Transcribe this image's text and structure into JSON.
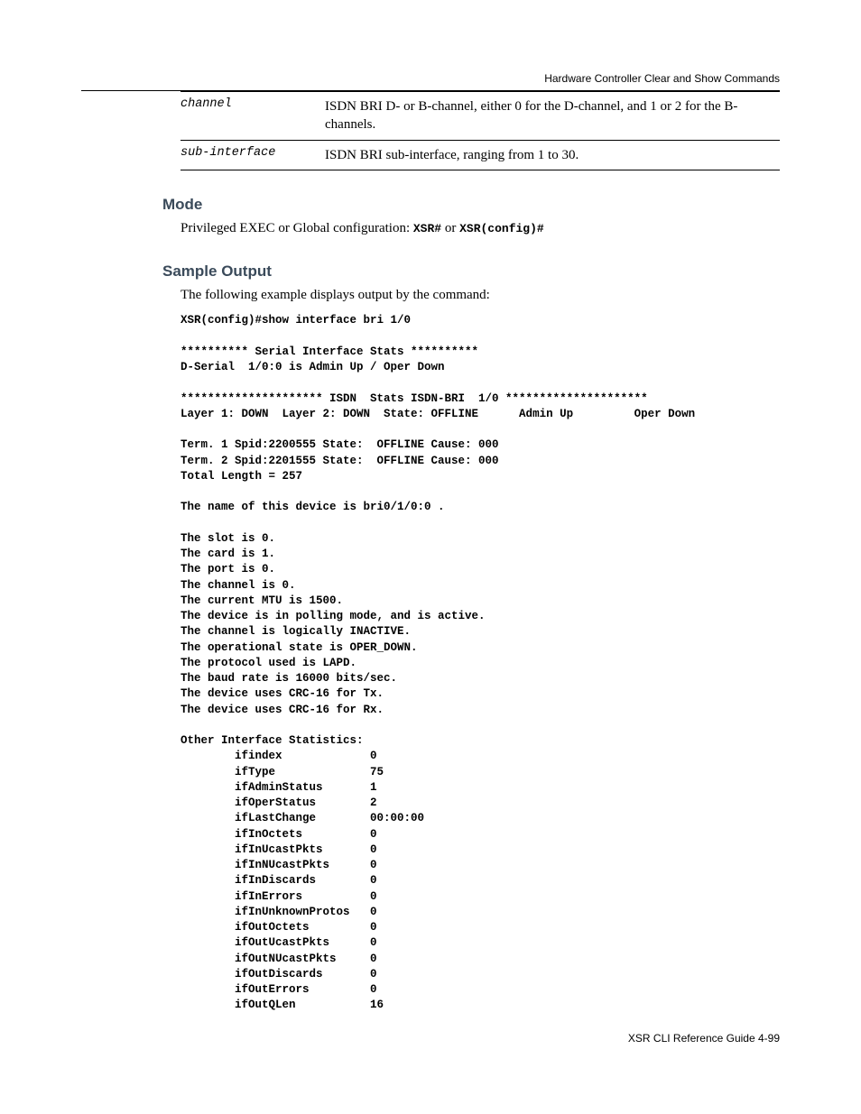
{
  "header": {
    "label": "Hardware Controller Clear and Show Commands"
  },
  "parameters": [
    {
      "name": "channel",
      "desc": "ISDN BRI D- or B-channel, either 0 for the D-channel, and 1 or 2 for the B-channels."
    },
    {
      "name": "sub-interface",
      "desc": "ISDN BRI sub-interface, ranging from 1 to 30."
    }
  ],
  "mode": {
    "heading": "Mode",
    "line_prefix": "Privileged EXEC or Global configuration: ",
    "code1": "XSR#",
    "mid": " or ",
    "code2": "XSR(config)#"
  },
  "sample": {
    "heading": "Sample Output",
    "intro": "The following example displays output by the command:",
    "output": "XSR(config)#show interface bri 1/0\n\n********** Serial Interface Stats **********\nD-Serial  1/0:0 is Admin Up / Oper Down\n\n********************* ISDN  Stats ISDN-BRI  1/0 *********************\nLayer 1: DOWN  Layer 2: DOWN  State: OFFLINE      Admin Up         Oper Down\n\nTerm. 1 Spid:2200555 State:  OFFLINE Cause: 000\nTerm. 2 Spid:2201555 State:  OFFLINE Cause: 000\nTotal Length = 257\n\nThe name of this device is bri0/1/0:0 .\n\nThe slot is 0.\nThe card is 1.\nThe port is 0.\nThe channel is 0.\nThe current MTU is 1500.\nThe device is in polling mode, and is active.\nThe channel is logically INACTIVE.\nThe operational state is OPER_DOWN.\nThe protocol used is LAPD.\nThe baud rate is 16000 bits/sec.\nThe device uses CRC-16 for Tx.\nThe device uses CRC-16 for Rx.\n\nOther Interface Statistics:\n        ifindex             0\n        ifType              75\n        ifAdminStatus       1\n        ifOperStatus        2\n        ifLastChange        00:00:00\n        ifInOctets          0\n        ifInUcastPkts       0\n        ifInNUcastPkts      0\n        ifInDiscards        0\n        ifInErrors          0\n        ifInUnknownProtos   0\n        ifOutOctets         0\n        ifOutUcastPkts      0\n        ifOutNUcastPkts     0\n        ifOutDiscards       0\n        ifOutErrors         0\n        ifOutQLen           16"
  },
  "footer": {
    "text": "XSR CLI Reference Guide   4-99"
  }
}
